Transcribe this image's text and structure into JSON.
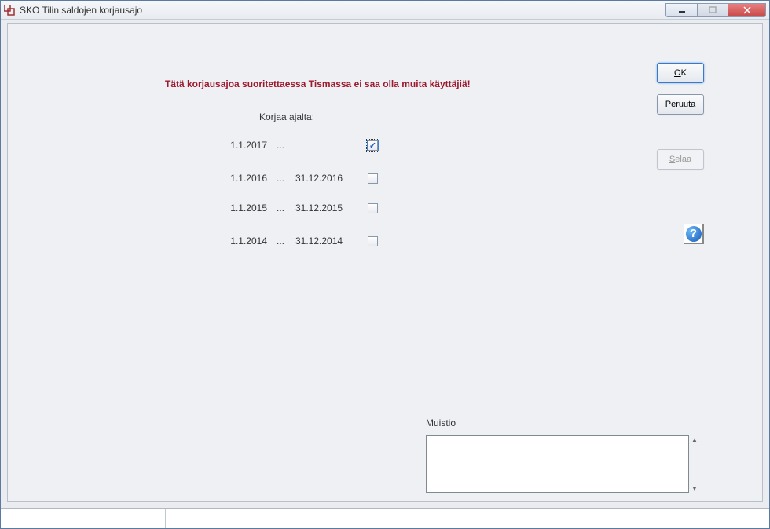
{
  "window": {
    "title": "SKO  Tilin saldojen korjausajo"
  },
  "content": {
    "warning": "Tätä korjausajoa suoritettaessa Tismassa ei saa olla muita käyttäjiä!",
    "section_label": "Korjaa ajalta:",
    "rows": [
      {
        "start": "1.1.2017",
        "sep": "...",
        "end": "",
        "checked": true
      },
      {
        "start": "1.1.2016",
        "sep": "...",
        "end": "31.12.2016",
        "checked": false
      },
      {
        "start": "1.1.2015",
        "sep": "...",
        "end": "31.12.2015",
        "checked": false
      },
      {
        "start": "1.1.2014",
        "sep": "...",
        "end": "31.12.2014",
        "checked": false
      }
    ]
  },
  "buttons": {
    "ok": "OK",
    "ok_prefix": "O",
    "ok_rest": "K",
    "cancel": "Peruuta",
    "browse_prefix": "S",
    "browse_rest": "elaa"
  },
  "memo": {
    "label": "Muistio",
    "value": ""
  },
  "icons": {
    "help": "?"
  }
}
